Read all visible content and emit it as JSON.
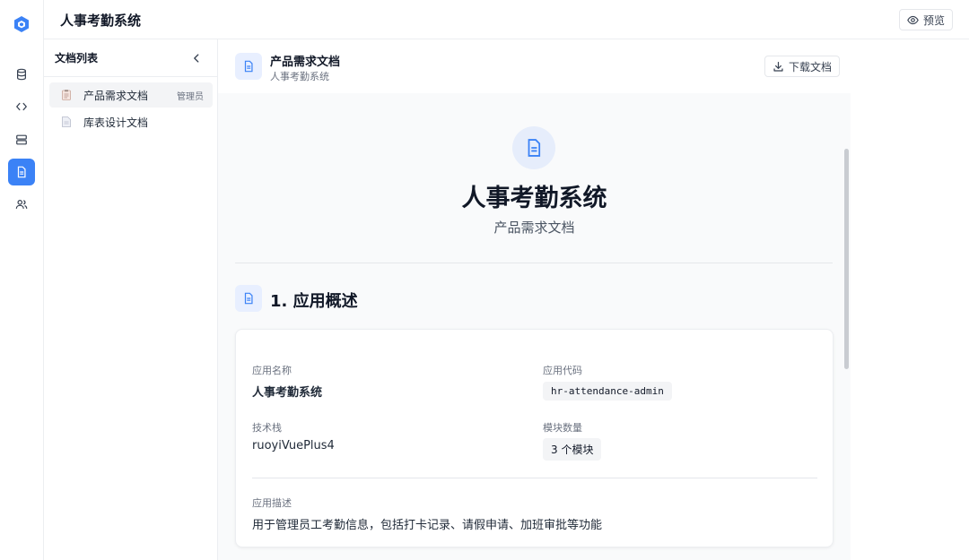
{
  "app": {
    "title": "人事考勤系统",
    "preview_label": "预览",
    "accent_color": "#3b82f6"
  },
  "rail": {
    "items": [
      {
        "icon": "database-icon",
        "active": false
      },
      {
        "icon": "code-icon",
        "active": false
      },
      {
        "icon": "server-icon",
        "active": false
      },
      {
        "icon": "document-icon",
        "active": true
      },
      {
        "icon": "users-icon",
        "active": false
      }
    ]
  },
  "doclist": {
    "title": "文档列表",
    "items": [
      {
        "label": "产品需求文档",
        "badge": "管理员",
        "active": true
      },
      {
        "label": "库表设计文档",
        "badge": "",
        "active": false
      }
    ]
  },
  "header": {
    "title": "产品需求文档",
    "subtitle": "人事考勤系统",
    "download_label": "下载文档"
  },
  "document": {
    "title": "人事考勤系统",
    "subtitle": "产品需求文档",
    "section1": {
      "title": "1. 应用概述",
      "app_name_label": "应用名称",
      "app_name": "人事考勤系统",
      "app_code_label": "应用代码",
      "app_code": "hr-attendance-admin",
      "tech_stack_label": "技术栈",
      "tech_stack": "ruoyiVuePlus4",
      "module_count_label": "模块数量",
      "module_count": "3 个模块",
      "description_label": "应用描述",
      "description": "用于管理员工考勤信息，包括打卡记录、请假申请、加班审批等功能"
    }
  }
}
